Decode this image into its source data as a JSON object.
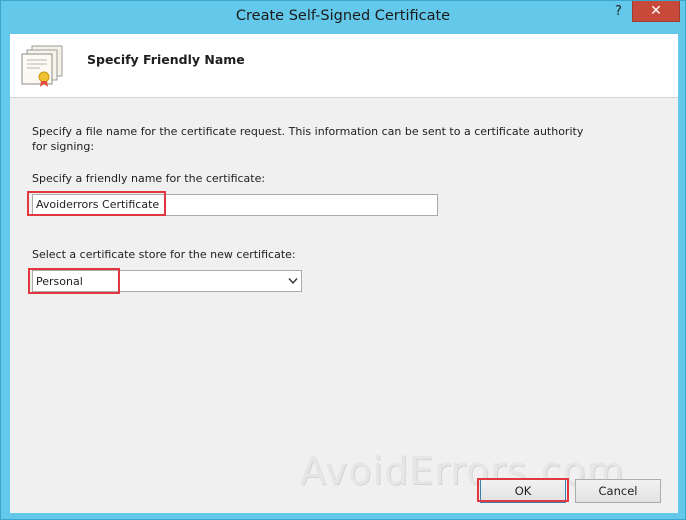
{
  "window": {
    "title": "Create Self-Signed Certificate",
    "help_label": "?",
    "close_label": "✕"
  },
  "header": {
    "title": "Specify Friendly Name",
    "icon": "certificate-icon"
  },
  "form": {
    "description": "Specify a file name for the certificate request.  This information can be sent to a certificate authority for signing:",
    "friendly_name_label": "Specify a friendly name for the certificate:",
    "friendly_name_value": "Avoiderrors Certificate",
    "store_label": "Select a certificate store for the new certificate:",
    "store_value": "Personal"
  },
  "buttons": {
    "ok": "OK",
    "cancel": "Cancel"
  },
  "watermark": "AvoidErrors.com",
  "colors": {
    "titlebar": "#64c8ea",
    "close_button": "#c7493a",
    "highlight": "#e0383e"
  }
}
